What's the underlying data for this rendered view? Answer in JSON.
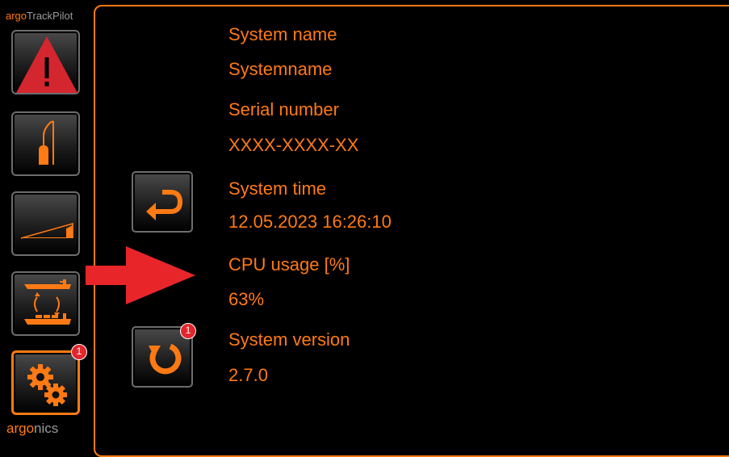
{
  "brand": {
    "top_prefix": "argo",
    "top_suffix": "TrackPilot",
    "bottom_prefix": "argo",
    "bottom_suffix": "nics"
  },
  "sidebar": {
    "items": [
      {
        "icon": "warning-triangle-icon"
      },
      {
        "icon": "pole-sensor-icon"
      },
      {
        "icon": "ramp-icon"
      },
      {
        "icon": "ship-swap-icon"
      },
      {
        "icon": "gears-icon",
        "active": true,
        "badge": "1"
      }
    ]
  },
  "actions": {
    "back": {
      "icon": "return-arrow-icon"
    },
    "refresh": {
      "icon": "refresh-icon",
      "badge": "1"
    }
  },
  "info": {
    "system_name_label": "System name",
    "system_name_value": "Systemname",
    "serial_label": "Serial number",
    "serial_value": "XXXX-XXXX-XX",
    "time_label": "System time",
    "time_value": "12.05.2023 16:26:10",
    "cpu_label": "CPU usage [%]",
    "cpu_value": "63%",
    "version_label": "System version",
    "version_value": "2.7.0"
  },
  "colors": {
    "accent": "#ff7a14",
    "alert": "#e3262c",
    "muted": "#9a9a9a"
  }
}
